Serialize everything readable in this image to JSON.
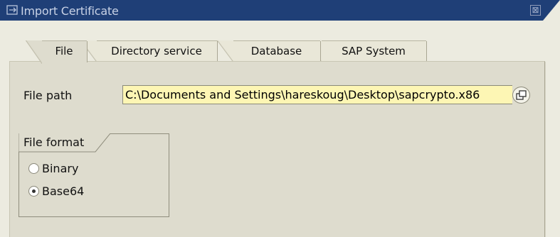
{
  "window": {
    "title": "Import Certificate",
    "close_symbol": "⊠"
  },
  "tabs": [
    {
      "label": "File",
      "active": true
    },
    {
      "label": "Directory service",
      "active": false
    },
    {
      "label": "Database",
      "active": false
    },
    {
      "label": "SAP System",
      "active": false
    }
  ],
  "file_path": {
    "label": "File path",
    "value": "C:\\Documents and Settings\\hareskoug\\Desktop\\sapcrypto.x86"
  },
  "file_format": {
    "title": "File format",
    "options": [
      {
        "label": "Binary",
        "selected": false
      },
      {
        "label": "Base64",
        "selected": true
      }
    ]
  },
  "colors": {
    "titlebar": "#1f3f77",
    "input_required": "#fdf6b4",
    "panel": "#dedcce"
  }
}
